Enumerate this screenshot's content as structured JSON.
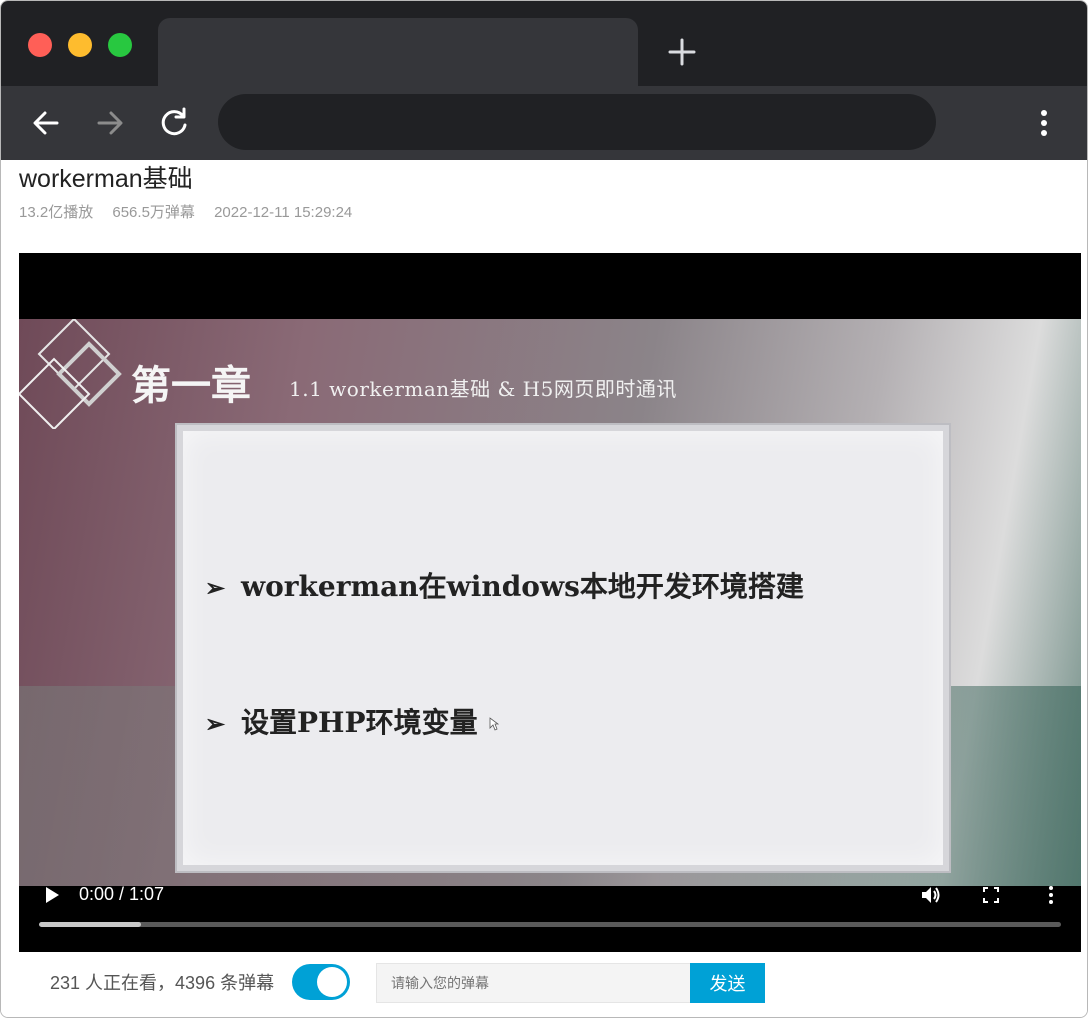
{
  "browser": {
    "tab_title": "",
    "address": ""
  },
  "video": {
    "title": "workerman基础",
    "plays": "13.2亿播放",
    "danmaku_count": "656.5万弹幕",
    "published": "2022-12-11 15:29:24"
  },
  "slide": {
    "chapter": "第一章",
    "subtitle": "1.1 workerman基础 & H5网页即时通讯",
    "bullet_mark": "➢",
    "bullets": [
      "workerman在windows本地开发环境搭建",
      "设置PHP环境变量"
    ]
  },
  "player": {
    "time": "0:00 / 1:07",
    "progress": 0.1,
    "icons": [
      "play-icon",
      "volume-icon",
      "fullscreen-icon",
      "more-vertical-icon"
    ]
  },
  "danmaku": {
    "status": "231 人正在看，4396 条弹幕",
    "toggle_on": true,
    "input_placeholder": "请输入您的弹幕",
    "send_label": "发送"
  },
  "colors": {
    "accent": "#00a1d6",
    "chrome_dark": "#202124",
    "chrome_toolbar": "#35363a"
  }
}
